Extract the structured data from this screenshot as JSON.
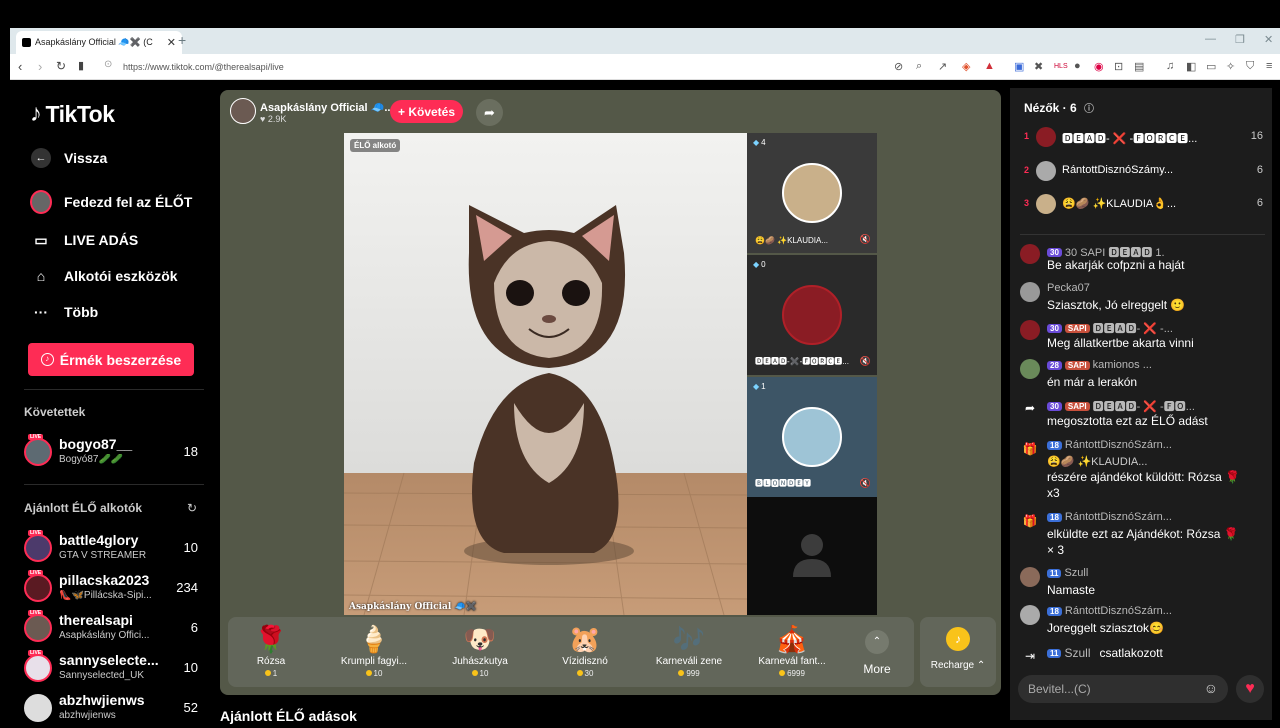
{
  "browser": {
    "tab_title": "Asapkáslány Official 🧢✖️ (C",
    "url": "https://www.tiktok.com/@therealsapi/live"
  },
  "sidebar": {
    "brand": "TikTok",
    "back": "Vissza",
    "items": [
      {
        "label": "Fedezd fel az ÉLŐT",
        "icon": "avatar-icon"
      },
      {
        "label": "LIVE ADÁS",
        "icon": "camera-icon"
      },
      {
        "label": "Alkotói eszközök",
        "icon": "house-icon"
      },
      {
        "label": "Több",
        "icon": "dots-icon"
      }
    ],
    "coins_button": "Érmék beszerzése",
    "followed_heading": "Követettek",
    "followed": [
      {
        "name": "bogyo87__",
        "sub": "Bogyó87🥒🥒",
        "count": "18"
      }
    ],
    "recommended_heading": "Ajánlott ÉLŐ alkotók",
    "recommended": [
      {
        "name": "battle4glory",
        "sub": "GTA V STREAMER",
        "count": "10"
      },
      {
        "name": "pillacska2023",
        "sub": "👠🦋Pillácska-Sipi...",
        "count": "234"
      },
      {
        "name": "therealsapi",
        "sub": "Asapkáslány Offici...",
        "count": "6"
      },
      {
        "name": "sannyselecte...",
        "sub": "Sannyselected_UK",
        "count": "10"
      },
      {
        "name": "abzhwjienws",
        "sub": "abzhwjienws",
        "count": "52"
      }
    ]
  },
  "stream": {
    "host_name": "Asapkáslány Official 🧢...",
    "host_likes": "♥ 2.9K",
    "follow_button": "+ Követés",
    "live_badge": "ÉLŐ alkotó",
    "watermark": "Asapkáslány Official 🧢✖️",
    "guests": [
      {
        "count": "4",
        "name": "😩🥔 ✨KLAUDIA..."
      },
      {
        "count": "0",
        "name": "🅳🅴🅰🅳-✖️-🅵🅾🆁🅲🅴..."
      },
      {
        "count": "1",
        "name": "🅱🅻🅾🅽🅳🅴🆈"
      },
      {
        "count": "",
        "name": ""
      }
    ],
    "below_heading": "Ajánlott ÉLŐ adások"
  },
  "gifts": [
    {
      "name": "Rózsa",
      "price": "1",
      "icon": "🌹"
    },
    {
      "name": "Krumpli fagyi...",
      "price": "10",
      "icon": "🍦"
    },
    {
      "name": "Juhászkutya",
      "price": "10",
      "icon": "🐶"
    },
    {
      "name": "Vízidisznó",
      "price": "30",
      "icon": "🐹"
    },
    {
      "name": "Karneváli zene",
      "price": "999",
      "icon": "🎶"
    },
    {
      "name": "Karnevál fant...",
      "price": "6999",
      "icon": "🎪"
    }
  ],
  "gift_more": "More",
  "recharge": "Recharge ⌃",
  "chat": {
    "viewers_label": "Nézők · 6",
    "top_viewers": [
      {
        "rank": "1",
        "name": "🅳🅴🅰🅳- ❌ -🅵🅾🆁🅲🅴...",
        "count": "16"
      },
      {
        "rank": "2",
        "name": "RántottDisznóSzámy...",
        "count": "6"
      },
      {
        "rank": "3",
        "name": "😩🥔 ✨KLAUDIA👌...",
        "count": "6"
      }
    ],
    "messages": [
      {
        "head": "30 SAPI 🅳🅴🅰🅳 1.",
        "text": "Be akarják cofpzni a haját",
        "lv": "30"
      },
      {
        "head": "Pecka07",
        "text": "Sziasztok, Jó elreggelt 🙂",
        "lv": ""
      },
      {
        "head": "🅳🅴🅰🅳- ❌ -...",
        "text": "Meg állatkertbe akarta vinni",
        "lv": "30"
      },
      {
        "head": "kamionos ...",
        "text": "én már a lerakón",
        "lv": "28"
      },
      {
        "head": "🅳🅴🅰🅳- ❌ -🅵🅾...",
        "text": "megosztotta ezt az ÉLŐ adást",
        "lv": "30"
      },
      {
        "head": "RántottDisznóSzárn...",
        "text": "😩🥔 ✨KLAUDIA...",
        "text2": "részére ajándékot küldött: Rózsa 🌹",
        "text3": "x3",
        "lv": "18"
      },
      {
        "head": "RántottDisznóSzárn...",
        "text": "elküldte ezt az Ajándékot: Rózsa 🌹",
        "text2": "× 3",
        "lv": "18"
      },
      {
        "head": "Szull",
        "text": "Namaste",
        "lv": "11"
      },
      {
        "head": "RántottDisznóSzárn...",
        "text": "Joreggelt sziasztok😊",
        "lv": "18"
      },
      {
        "head": "Szull",
        "text": "csatlakozott",
        "lv": "11"
      }
    ],
    "input_placeholder": "Bevitel...(C)"
  }
}
